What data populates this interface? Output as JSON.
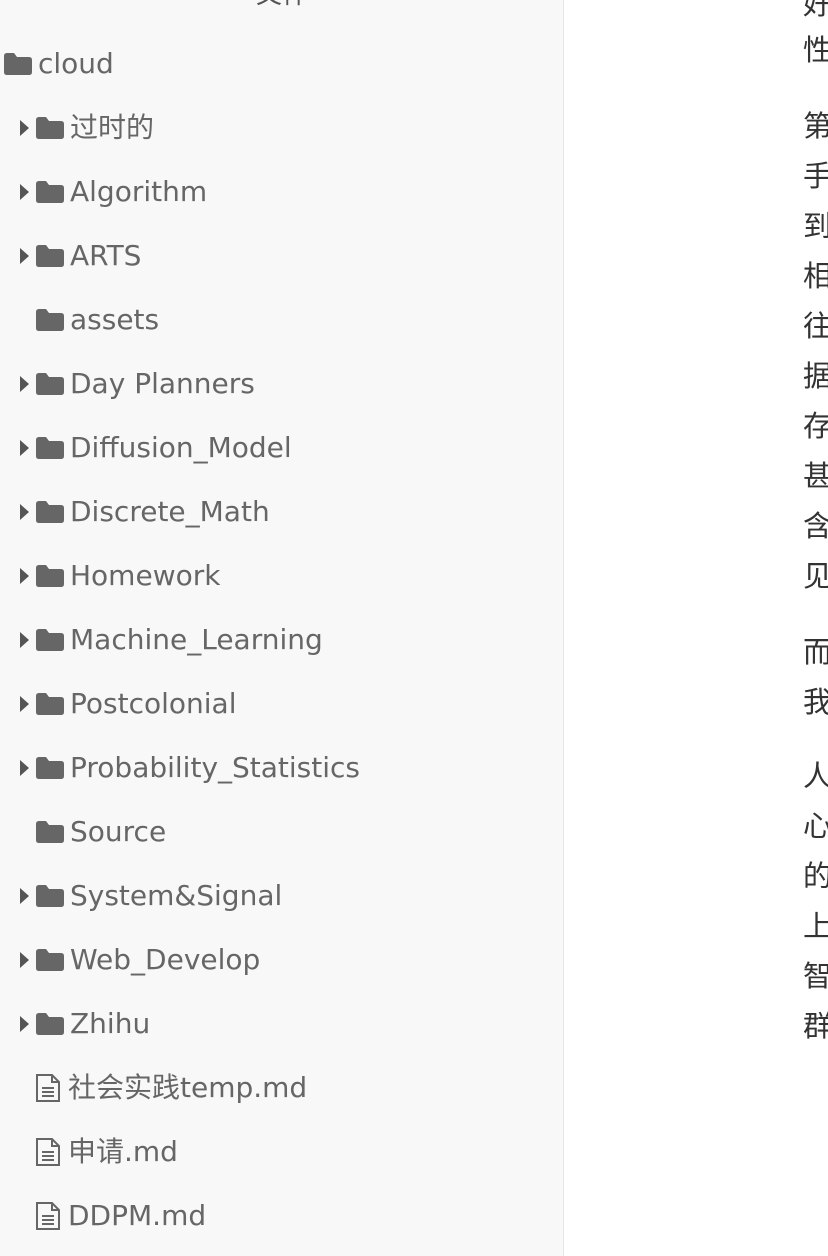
{
  "sidebar": {
    "header": "文件",
    "root": {
      "label": "cloud",
      "icon": "folder-icon"
    },
    "items": [
      {
        "label": "过时的",
        "type": "folder",
        "expandable": true
      },
      {
        "label": "Algorithm",
        "type": "folder",
        "expandable": true
      },
      {
        "label": "ARTS",
        "type": "folder",
        "expandable": true
      },
      {
        "label": "assets",
        "type": "folder",
        "expandable": false
      },
      {
        "label": "Day Planners",
        "type": "folder",
        "expandable": true
      },
      {
        "label": "Diffusion_Model",
        "type": "folder",
        "expandable": true
      },
      {
        "label": "Discrete_Math",
        "type": "folder",
        "expandable": true
      },
      {
        "label": "Homework",
        "type": "folder",
        "expandable": true
      },
      {
        "label": "Machine_Learning",
        "type": "folder",
        "expandable": true
      },
      {
        "label": "Postcolonial",
        "type": "folder",
        "expandable": true
      },
      {
        "label": "Probability_Statistics",
        "type": "folder",
        "expandable": true
      },
      {
        "label": "Source",
        "type": "folder",
        "expandable": false
      },
      {
        "label": "System&Signal",
        "type": "folder",
        "expandable": true
      },
      {
        "label": "Web_Develop",
        "type": "folder",
        "expandable": true
      },
      {
        "label": "Zhihu",
        "type": "folder",
        "expandable": true
      },
      {
        "label": "社会实践temp.md",
        "type": "file",
        "expandable": false
      },
      {
        "label": "申请.md",
        "type": "file",
        "expandable": false
      },
      {
        "label": "DDPM.md",
        "type": "file",
        "expandable": false
      }
    ]
  },
  "editor": {
    "lines": [
      "好",
      "性",
      "第",
      "手",
      "到",
      "相",
      "往",
      "据",
      "存",
      "甚",
      "含",
      "见",
      "而",
      "我",
      "人",
      "心",
      "的",
      "上",
      "智",
      "群"
    ]
  },
  "colors": {
    "sidebar_bg": "#f8f8f8",
    "icon": "#666666",
    "text": "#666666"
  }
}
